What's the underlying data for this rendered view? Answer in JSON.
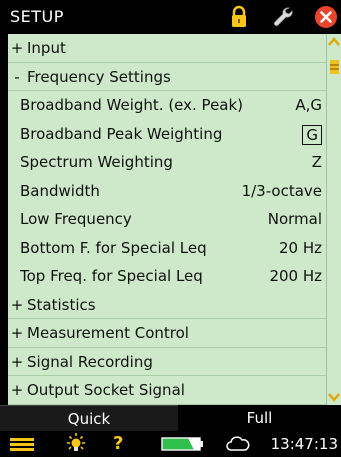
{
  "window": {
    "title": "SETUP"
  },
  "list": {
    "rows": [
      {
        "kind": "section",
        "expander": "+",
        "label": "Input"
      },
      {
        "kind": "section",
        "expander": "-",
        "label": "Frequency Settings"
      },
      {
        "kind": "param",
        "label": "Broadband Weight. (ex. Peak)",
        "value": "A,G"
      },
      {
        "kind": "param",
        "label": "Broadband Peak Weighting",
        "value": "G",
        "selected": true
      },
      {
        "kind": "param",
        "label": "Spectrum Weighting",
        "value": "Z"
      },
      {
        "kind": "param",
        "label": "Bandwidth",
        "value": "1/3-octave"
      },
      {
        "kind": "param",
        "label": "Low Frequency",
        "value": "Normal"
      },
      {
        "kind": "param",
        "label": "Bottom F. for Special Leq",
        "value": "20 Hz"
      },
      {
        "kind": "param",
        "label": "Top Freq. for Special Leq",
        "value": "200 Hz"
      },
      {
        "kind": "section",
        "expander": "+",
        "label": "Statistics"
      },
      {
        "kind": "section",
        "expander": "+",
        "label": "Measurement Control"
      },
      {
        "kind": "section",
        "expander": "+",
        "label": "Signal Recording"
      },
      {
        "kind": "section",
        "expander": "+",
        "label": "Output Socket Signal"
      }
    ]
  },
  "tabs": {
    "quick": "Quick",
    "full": "Full",
    "active": "quick"
  },
  "status": {
    "time": "13:47:13"
  },
  "icons": {
    "lock": "lock-icon",
    "wrench": "wrench-icon",
    "close": "close-icon",
    "menu": "menu-icon",
    "bulb": "lightbulb-icon",
    "help": "?",
    "battery": "battery-icon",
    "cloud": "cloud-icon"
  },
  "colors": {
    "background_list": "#cde9c9",
    "chrome": "#000000",
    "accent_yellow": "#f5c518",
    "close_red": "#e8452c",
    "battery_green": "#2fbf4a"
  }
}
